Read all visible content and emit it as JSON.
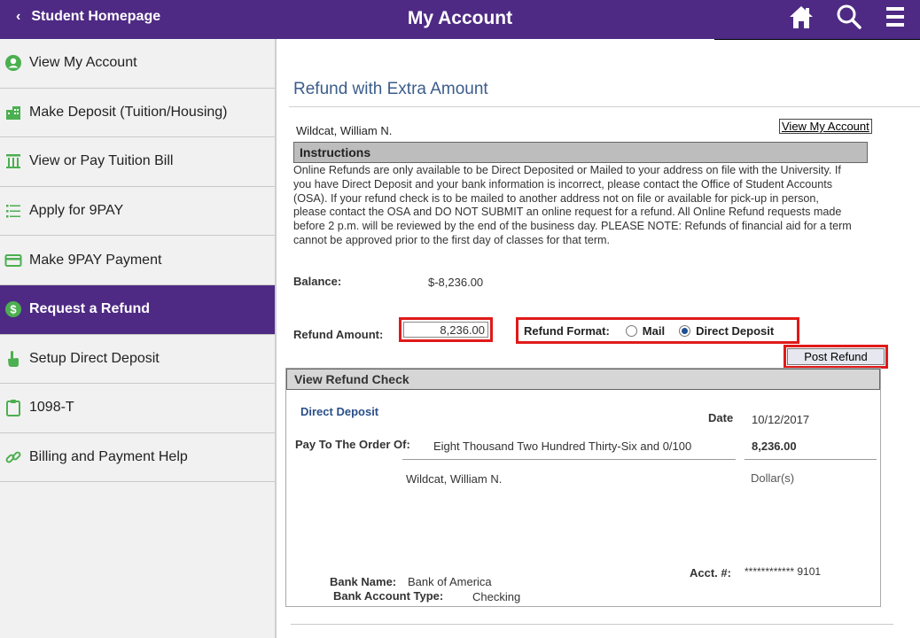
{
  "header": {
    "back_label": "Student Homepage",
    "title": "My Account",
    "icons": [
      "home-icon",
      "search-icon",
      "menu-icon"
    ]
  },
  "sidebar": {
    "items": [
      {
        "label": "View My Account",
        "icon": "user-circle-icon",
        "active": false
      },
      {
        "label": "Make Deposit (Tuition/Housing)",
        "icon": "building-icon",
        "active": false
      },
      {
        "label": "View or Pay Tuition Bill",
        "icon": "columns-icon",
        "active": false
      },
      {
        "label": "Apply for 9PAY",
        "icon": "list-icon",
        "active": false
      },
      {
        "label": "Make 9PAY Payment",
        "icon": "credit-card-icon",
        "active": false
      },
      {
        "label": "Request a Refund",
        "icon": "dollar-circle-icon",
        "active": true
      },
      {
        "label": "Setup Direct Deposit",
        "icon": "hand-pointer-icon",
        "active": false
      },
      {
        "label": "1098-T",
        "icon": "clipboard-icon",
        "active": false
      },
      {
        "label": "Billing and Payment Help",
        "icon": "link-icon",
        "active": false
      }
    ]
  },
  "main": {
    "heading": "Refund with Extra Amount",
    "student_name": "Wildcat, William N.",
    "view_account_link": "View My Account",
    "instructions_title": "Instructions",
    "instructions_text": "Online Refunds are only available to be Direct Deposited or Mailed to your address on file with the University. If you have Direct Deposit and your bank information is incorrect, please contact the Office of Student Accounts (OSA). If your refund check is to be mailed to another address not on file or available for pick-up in person, please contact the OSA and DO NOT SUBMIT an online request for a refund. All Online Refund requests made before 2 p.m. will be reviewed by the end of the business day. PLEASE NOTE: Refunds of financial aid for a term cannot be approved prior to the first day of classes for that term.",
    "balance_label": "Balance:",
    "balance_value": "$-8,236.00",
    "refund_amount_label": "Refund Amount:",
    "refund_amount_value": "8,236.00",
    "refund_format_label": "Refund Format:",
    "format_options": [
      "Mail",
      "Direct Deposit"
    ],
    "format_selected": "Direct Deposit",
    "post_button": "Post Refund"
  },
  "check": {
    "title": "View Refund Check",
    "type": "Direct Deposit",
    "date_label": "Date",
    "date_value": "10/12/2017",
    "pay_to_label": "Pay To The Order Of:",
    "amount_words": "Eight Thousand Two Hundred Thirty-Six and 0/100",
    "amount_value": "8,236.00",
    "payee": "Wildcat, William N.",
    "dollars_label": "Dollar(s)",
    "bank_name_label": "Bank Name:",
    "bank_name": "Bank of America",
    "account_type_label": "Bank Account Type:",
    "account_type": "Checking",
    "acct_label": "Acct. #:",
    "acct_value": "************ 9101"
  },
  "colors": {
    "brand_purple": "#4e2a84",
    "highlight_red": "#e01a1a",
    "heading_blue": "#3b5d8a",
    "icon_green": "#4caf50"
  }
}
